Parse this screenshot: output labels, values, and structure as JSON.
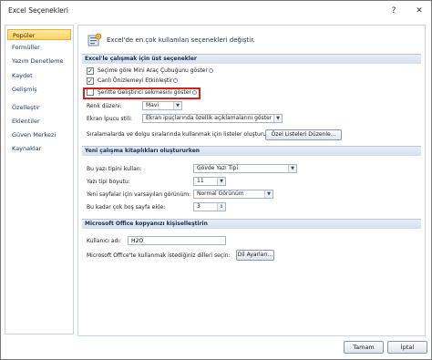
{
  "window": {
    "title": "Excel Seçenekleri",
    "help": "?",
    "close": "✕"
  },
  "sidebar": {
    "items": [
      {
        "label": "Popüler"
      },
      {
        "label": "Formüller"
      },
      {
        "label": "Yazım Denetleme"
      },
      {
        "label": "Kaydet"
      },
      {
        "label": "Gelişmiş"
      },
      {
        "label": "Özelleştir"
      },
      {
        "label": "Eklentiler"
      },
      {
        "label": "Güven Merkezi"
      },
      {
        "label": "Kaynaklar"
      }
    ],
    "active_index": 0
  },
  "banner": {
    "text": "Excel'de en çok kullanılan seçenekleri değiştir."
  },
  "sections": {
    "top": "Excel'le çalışmak için üst seçenekler",
    "new_workbook": "Yeni çalışma kitaplıkları oluştururken",
    "personalize": "Microsoft Office kopyanızı kişiselleştirin"
  },
  "top_options": {
    "checkboxes": [
      {
        "label": "Seçime göre Mini Araç Çubuğunu göster",
        "checked": true
      },
      {
        "label": "Canlı Önizlemeyi Etkinleştir",
        "checked": true
      },
      {
        "label": "Şeritte Geliştirici sekmesini göster",
        "checked": false
      }
    ],
    "color_label": "Renk düzeni:",
    "color_value": "Mavi",
    "tooltip_label": "Ekran İpucu stili:",
    "tooltip_value": "Ekran ipuçlarında özellik açıklamalarını göster",
    "sort_label": "Sıralamalarda ve dolgu sıralarında kullanmak için listeler oluşturun:",
    "sort_button": "Özel Listeleri Düzenle..."
  },
  "new_workbook": {
    "font_label": "Bu yazı tipini kullan:",
    "font_value": "Gövde Yazı Tipi",
    "size_label": "Yazı tipi boyutu:",
    "size_value": "11",
    "view_label": "Yeni sayfalar için varsayılan görünüm:",
    "view_value": "Normal Görünüm",
    "sheets_label": "Bu kadar çok boş sayfa ekle:",
    "sheets_value": "3"
  },
  "personalize": {
    "user_label": "Kullanıcı adı:",
    "user_value": "H2O",
    "lang_label": "Microsoft Office'te kullanmak istediğiniz dilleri seçin:",
    "lang_button": "Dil Ayarları..."
  },
  "footer": {
    "ok": "Tamam",
    "cancel": "İptal"
  },
  "colors": {
    "accent": "#ffd25a",
    "highlight": "#d42020"
  }
}
